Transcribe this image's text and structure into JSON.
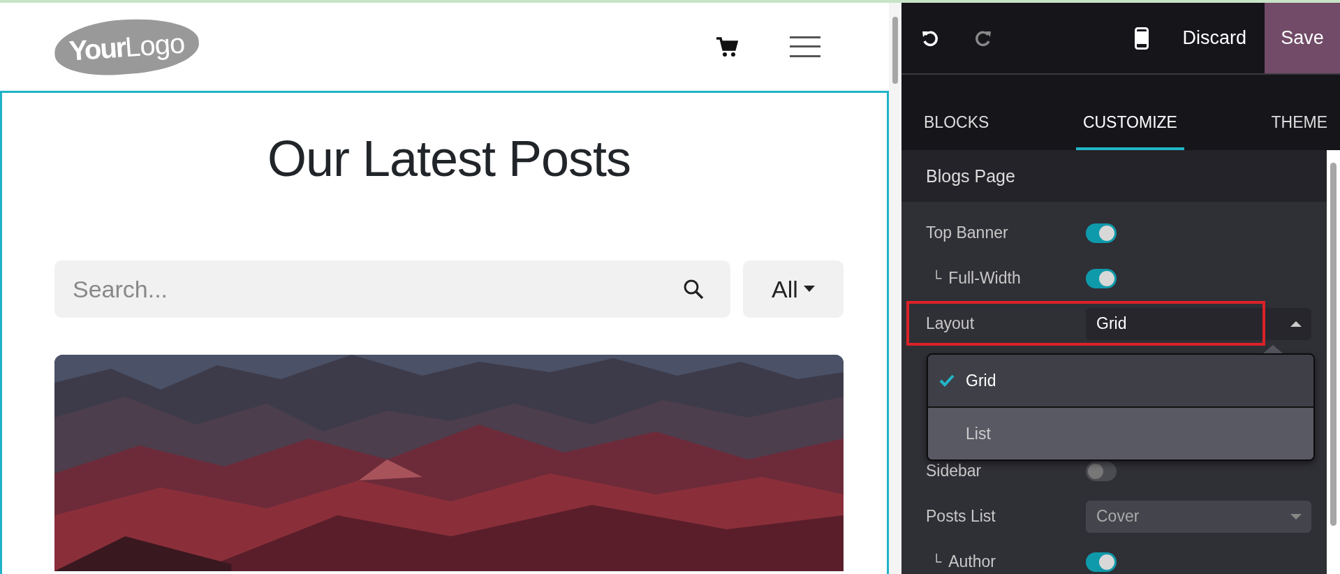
{
  "site": {
    "logo": {
      "bold_part": "Your",
      "light_part": "Logo"
    },
    "title": "Our Latest Posts",
    "search": {
      "placeholder": "Search..."
    },
    "filter": {
      "label": "All"
    }
  },
  "editor": {
    "toolbar": {
      "discard": "Discard",
      "save": "Save"
    },
    "tabs": [
      {
        "label": "BLOCKS",
        "selected": false
      },
      {
        "label": "CUSTOMIZE",
        "selected": true
      },
      {
        "label": "THEME",
        "selected": false
      }
    ],
    "section": "Blogs Page",
    "options": [
      {
        "label": "Top Banner",
        "kind": "toggle",
        "on": true,
        "children": [
          {
            "label": "Full-Width",
            "marker": "└",
            "kind": "toggle",
            "on": true
          }
        ]
      },
      {
        "label": "Layout",
        "kind": "select",
        "value": "Grid",
        "expanded": true,
        "highlighted": true,
        "menu": [
          {
            "label": "Grid",
            "selected": true
          },
          {
            "label": "List",
            "selected": false
          }
        ]
      },
      {
        "label": "Sidebar",
        "kind": "toggle",
        "on": false
      },
      {
        "label": "Posts List",
        "kind": "select",
        "value": "Cover",
        "expanded": false,
        "children": [
          {
            "label": "Author",
            "marker": "└",
            "kind": "toggle",
            "on": true
          }
        ]
      }
    ]
  }
}
